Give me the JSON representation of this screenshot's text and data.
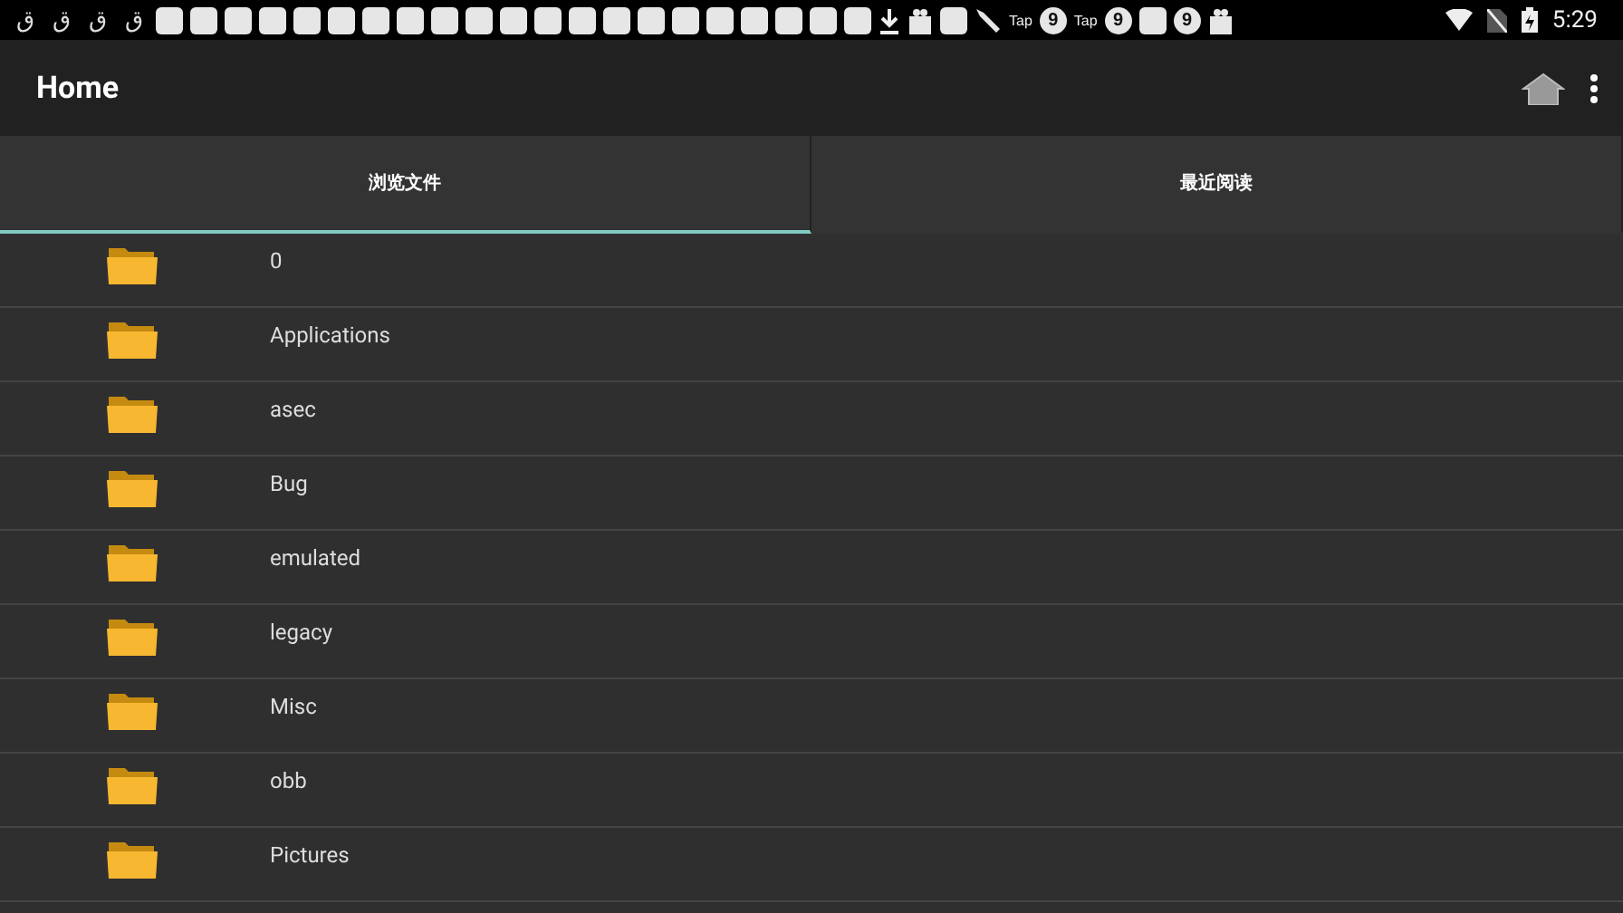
{
  "status_bar": {
    "notifications": [
      {
        "kind": "glyph",
        "text": "ق"
      },
      {
        "kind": "glyph",
        "text": "ق"
      },
      {
        "kind": "glyph",
        "text": "ق"
      },
      {
        "kind": "glyph",
        "text": "ق"
      },
      {
        "kind": "square"
      },
      {
        "kind": "square"
      },
      {
        "kind": "square"
      },
      {
        "kind": "square"
      },
      {
        "kind": "square"
      },
      {
        "kind": "square"
      },
      {
        "kind": "square"
      },
      {
        "kind": "square"
      },
      {
        "kind": "square"
      },
      {
        "kind": "square"
      },
      {
        "kind": "square"
      },
      {
        "kind": "square"
      },
      {
        "kind": "square"
      },
      {
        "kind": "square"
      },
      {
        "kind": "square"
      },
      {
        "kind": "square"
      },
      {
        "kind": "square"
      },
      {
        "kind": "square"
      },
      {
        "kind": "square"
      },
      {
        "kind": "square"
      },
      {
        "kind": "square"
      },
      {
        "kind": "download"
      },
      {
        "kind": "bag"
      },
      {
        "kind": "square"
      },
      {
        "kind": "tool"
      },
      {
        "kind": "tap",
        "text": "Tap"
      },
      {
        "kind": "badge",
        "text": "9"
      },
      {
        "kind": "tap",
        "text": "Tap"
      },
      {
        "kind": "badge",
        "text": "9"
      },
      {
        "kind": "square"
      },
      {
        "kind": "badge",
        "text": "9"
      },
      {
        "kind": "bag"
      }
    ],
    "time": "5:29"
  },
  "app_bar": {
    "title": "Home"
  },
  "tabs": [
    {
      "label": "浏览文件",
      "selected": true
    },
    {
      "label": "最近阅读",
      "selected": false
    }
  ],
  "files": [
    {
      "name": "0"
    },
    {
      "name": "Applications"
    },
    {
      "name": "asec"
    },
    {
      "name": "Bug"
    },
    {
      "name": "emulated"
    },
    {
      "name": "legacy"
    },
    {
      "name": "Misc"
    },
    {
      "name": "obb"
    },
    {
      "name": "Pictures"
    }
  ]
}
